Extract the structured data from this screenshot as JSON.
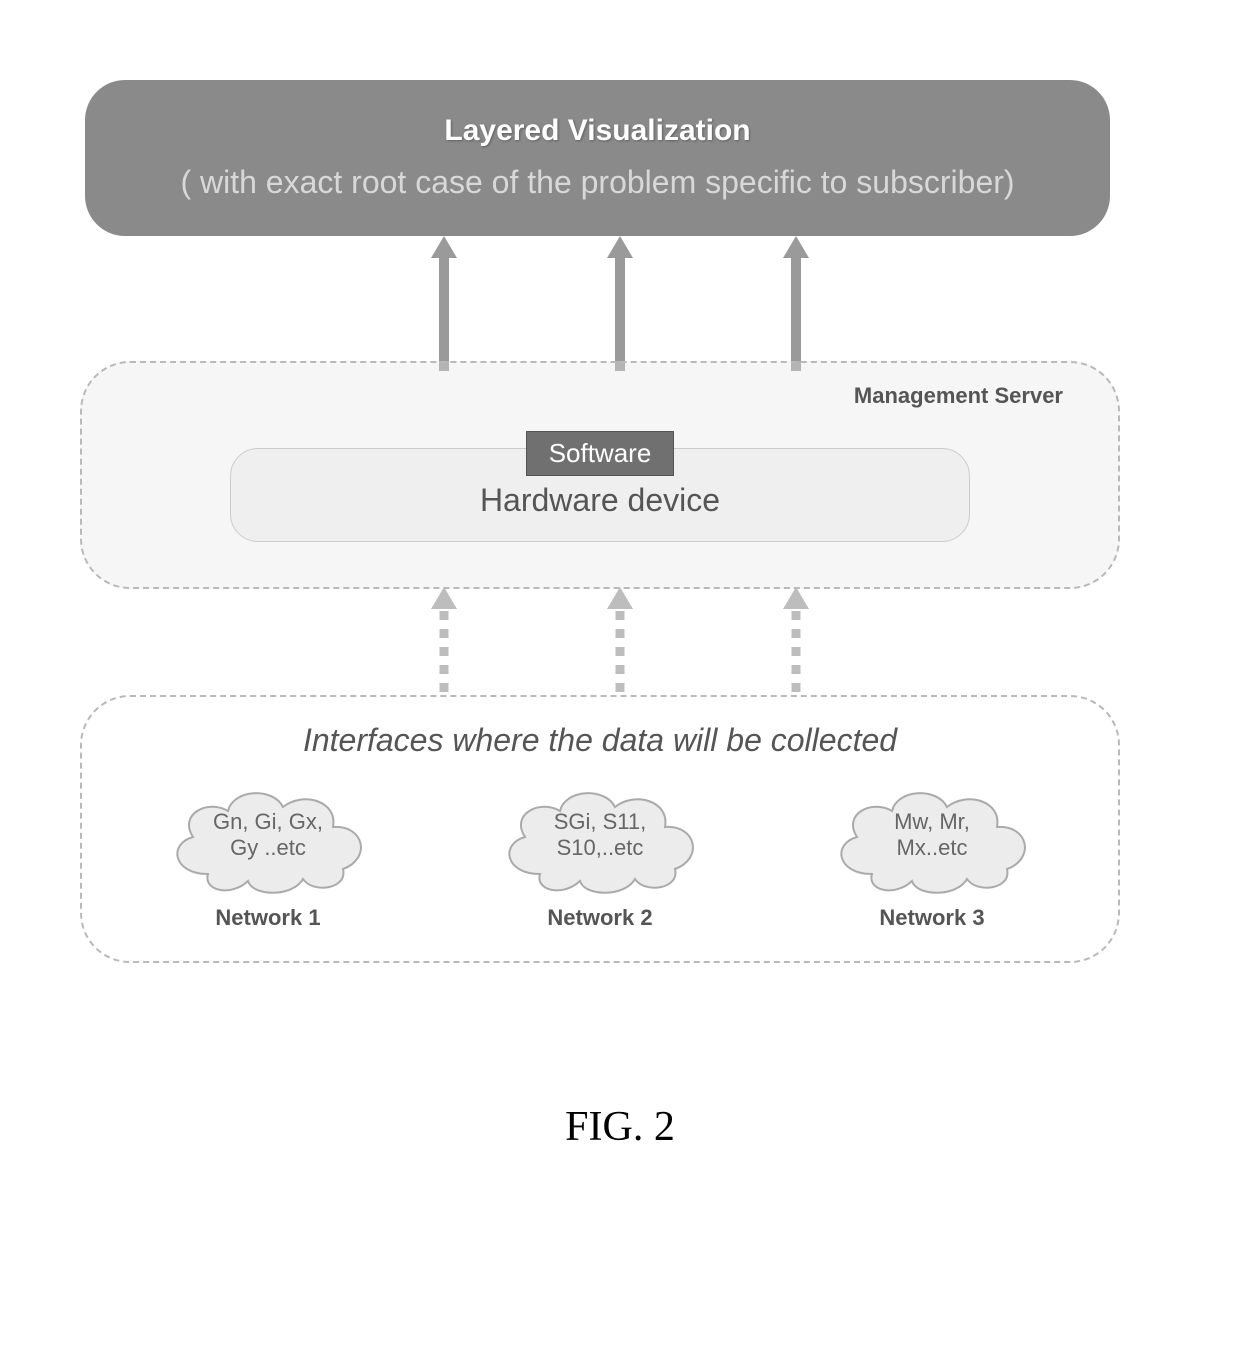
{
  "top_box": {
    "title": "Layered Visualization",
    "subtitle": "( with exact root case of the problem specific to subscriber)"
  },
  "management": {
    "box_label": "Management Server",
    "software_label": "Software",
    "hardware_label": "Hardware device"
  },
  "interfaces": {
    "title": "Interfaces where the data will be collected",
    "networks": [
      {
        "cloud_line1": "Gn, Gi, Gx,",
        "cloud_line2": "Gy ..etc",
        "label": "Network 1"
      },
      {
        "cloud_line1": "SGi, S11,",
        "cloud_line2": "S10,..etc",
        "label": "Network 2"
      },
      {
        "cloud_line1": "Mw, Mr,",
        "cloud_line2": "Mx..etc",
        "label": "Network 3"
      }
    ]
  },
  "figure_label": "FIG. 2"
}
